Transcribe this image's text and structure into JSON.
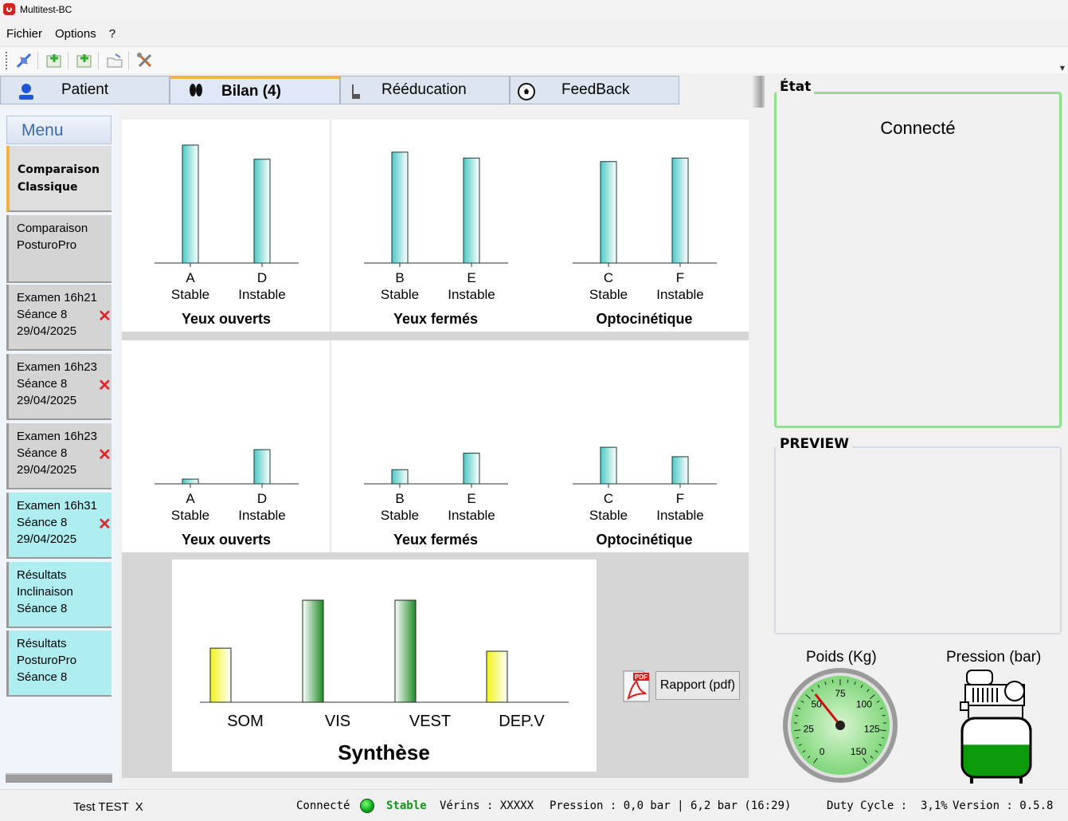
{
  "window": {
    "title": "Multitest-BC"
  },
  "menubar": {
    "items": [
      "Fichier",
      "Options",
      "?"
    ]
  },
  "toolbar": {
    "buttons": [
      "disconnect-icon",
      "add-green-icon",
      "add-green-2-icon",
      "open-folder-icon",
      "tools-icon"
    ]
  },
  "tabs": [
    {
      "label": "Patient",
      "icon": "person-icon"
    },
    {
      "label": "Bilan (4)",
      "icon": "footprints-icon",
      "active": true
    },
    {
      "label": "Rééducation",
      "icon": "foot-icon"
    },
    {
      "label": "FeedBack",
      "icon": "soccer-ball-icon"
    }
  ],
  "sidebar": {
    "menu_title": "Menu",
    "items": [
      {
        "line1": "Comparaison",
        "line2": "Classique",
        "line3": "",
        "state": "active"
      },
      {
        "line1": "Comparaison",
        "line2": "PosturoPro",
        "line3": "",
        "state": "normal"
      },
      {
        "line1": "Examen 16h21",
        "line2": "Séance 8",
        "line3": "29/04/2025",
        "state": "normal",
        "delete": "✕"
      },
      {
        "line1": "Examen 16h23",
        "line2": "Séance 8",
        "line3": "29/04/2025",
        "state": "normal",
        "delete": "✕"
      },
      {
        "line1": "Examen 16h23",
        "line2": "Séance 8",
        "line3": "29/04/2025",
        "state": "normal",
        "delete": "✕"
      },
      {
        "line1": "Examen 16h31",
        "line2": "Séance 8",
        "line3": "29/04/2025",
        "state": "cyan",
        "delete": "✕"
      },
      {
        "line1": "Résultats",
        "line2": "Inclinaison",
        "line3": "Séance 8",
        "state": "cyan"
      },
      {
        "line1": "Résultats",
        "line2": "PosturoPro",
        "line3": "Séance 8",
        "state": "cyan"
      }
    ]
  },
  "chart_data": [
    {
      "type": "bar",
      "group": "top",
      "title": "Yeux ouverts",
      "categories": [
        "A",
        "D"
      ],
      "sublabels": [
        "Stable",
        "Instable"
      ],
      "values": [
        100,
        88
      ],
      "ylim": [
        0,
        100
      ],
      "color": "#5fd0cc"
    },
    {
      "type": "bar",
      "group": "top",
      "title": "Yeux fermés",
      "categories": [
        "B",
        "E"
      ],
      "sublabels": [
        "Stable",
        "Instable"
      ],
      "values": [
        94,
        89
      ],
      "ylim": [
        0,
        100
      ],
      "color": "#5fd0cc"
    },
    {
      "type": "bar",
      "group": "top",
      "title": "Optocinétique",
      "categories": [
        "C",
        "F"
      ],
      "sublabels": [
        "Stable",
        "Instable"
      ],
      "values": [
        86,
        89
      ],
      "ylim": [
        0,
        100
      ],
      "color": "#5fd0cc"
    },
    {
      "type": "bar",
      "group": "bottom",
      "title": "Yeux ouverts",
      "categories": [
        "A",
        "D"
      ],
      "sublabels": [
        "Stable",
        "Instable"
      ],
      "values": [
        4,
        29
      ],
      "ylim": [
        0,
        100
      ],
      "color": "#5fd0cc"
    },
    {
      "type": "bar",
      "group": "bottom",
      "title": "Yeux fermés",
      "categories": [
        "B",
        "E"
      ],
      "sublabels": [
        "Stable",
        "Instable"
      ],
      "values": [
        12,
        26
      ],
      "ylim": [
        0,
        100
      ],
      "color": "#5fd0cc"
    },
    {
      "type": "bar",
      "group": "bottom",
      "title": "Optocinétique",
      "categories": [
        "C",
        "F"
      ],
      "sublabels": [
        "Stable",
        "Instable"
      ],
      "values": [
        31,
        23
      ],
      "ylim": [
        0,
        100
      ],
      "color": "#5fd0cc"
    },
    {
      "type": "bar",
      "group": "synthese",
      "title": "Synthèse",
      "categories": [
        "SOM",
        "VIS",
        "VEST",
        "DEP.V"
      ],
      "values": [
        53,
        100,
        100,
        50
      ],
      "ylim": [
        0,
        100
      ],
      "colors": [
        "#f4f41e",
        "#1f9a2a",
        "#1f9a2a",
        "#f4f41e"
      ]
    }
  ],
  "report": {
    "label": "Rapport (pdf)",
    "icon": "pdf-icon"
  },
  "right_panel": {
    "etat_title": "État",
    "etat_status": "Connecté",
    "preview_title": "PREVIEW",
    "poids_label": "Poids (Kg)",
    "poids_ticks": [
      "0",
      "25",
      "50",
      "75",
      "100",
      "125",
      "150"
    ],
    "poids_value": 55,
    "pression_label": "Pression (bar)",
    "tank_fill": 0.55
  },
  "statusbar": {
    "user": "Test TEST  X",
    "connection": "Connecté",
    "stability": "Stable",
    "verins": "Vérins : XXXXX",
    "pression": "Pression : 0,0 bar | 6,2 bar (16:29)",
    "duty": "Duty Cycle :  3,1%",
    "version": "Version : 0.5.8"
  },
  "colors": {
    "accent": "#f2b344",
    "teal": "#5fd0cc",
    "green_border": "#8fe08c",
    "led_green": "#0aa91a"
  }
}
